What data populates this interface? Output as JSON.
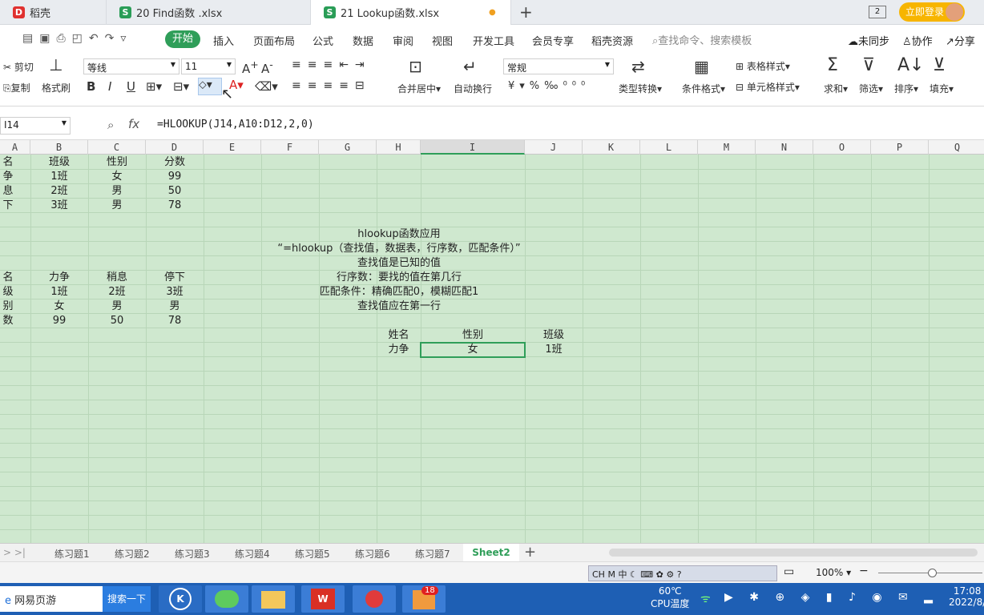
{
  "tabs": [
    {
      "label": "稻壳"
    },
    {
      "label": "20  Find函数 .xlsx"
    },
    {
      "label": "21  Lookup函数.xlsx"
    }
  ],
  "header_right": {
    "login": "立即登录",
    "page_count": "2"
  },
  "menu": {
    "start": "开始",
    "items": [
      "插入",
      "页面布局",
      "公式",
      "数据",
      "审阅",
      "视图",
      "开发工具",
      "会员专享",
      "稻壳资源"
    ],
    "search": "查找命令、搜索模板",
    "unsync": "未同步",
    "collab": "协作",
    "share": "分享"
  },
  "ribbon": {
    "cut": "剪切",
    "copy": "复制",
    "format_painter": "格式刷",
    "font_name": "等线",
    "font_size": "11",
    "merge": "合并居中",
    "wrap": "自动换行",
    "number_format": "常规",
    "type_convert": "类型转换",
    "cond_format": "条件格式",
    "table_style": "表格样式",
    "cell_style": "单元格样式",
    "sum": "求和",
    "filter": "筛选",
    "sort": "排序",
    "fill": "填充"
  },
  "formula_bar": {
    "cell_ref": "I14",
    "fx": "fx",
    "formula": "=HLOOKUP(J14,A10:D12,2,0)"
  },
  "columns": [
    "A",
    "B",
    "C",
    "D",
    "E",
    "F",
    "G",
    "H",
    "I",
    "J",
    "K",
    "L",
    "M",
    "N",
    "O",
    "P",
    "Q"
  ],
  "table1": {
    "header": [
      "名",
      "班级",
      "性别",
      "分数"
    ],
    "rows": [
      [
        "争",
        "1班",
        "女",
        "99"
      ],
      [
        "息",
        "2班",
        "男",
        "50"
      ],
      [
        "下",
        "3班",
        "男",
        "78"
      ]
    ]
  },
  "table2": {
    "rows": [
      [
        "名",
        "力争",
        "稍息",
        "停下"
      ],
      [
        "级",
        "1班",
        "2班",
        "3班"
      ],
      [
        "别",
        "女",
        "男",
        "男"
      ],
      [
        "数",
        "99",
        "50",
        "78"
      ]
    ]
  },
  "notes": [
    "hlookup函数应用",
    "“=hlookup（查找值，数据表，行序数，匹配条件）”",
    "查找值是已知的值",
    "行序数：要找的值在第几行",
    "匹配条件：精确匹配0，模糊匹配1",
    "查找值应在第一行"
  ],
  "lookup": {
    "h_label": "姓名",
    "i_label": "性别",
    "j_label": "班级",
    "h_val": "力争",
    "i_val": "女",
    "j_val": "1班"
  },
  "sheets": [
    "练习题1",
    "练习题2",
    "练习题3",
    "练习题4",
    "练习题5",
    "练习题6",
    "练习题7",
    "Sheet2"
  ],
  "status": {
    "zoom": "100%",
    "ime": "CH",
    "ime2": "中"
  },
  "taskbar": {
    "browser": "网易页游",
    "search": "搜索一下",
    "cpu_temp": "60℃",
    "cpu_label": "CPU温度",
    "time": "17:08",
    "date": "2022/8/",
    "badge": "18"
  }
}
